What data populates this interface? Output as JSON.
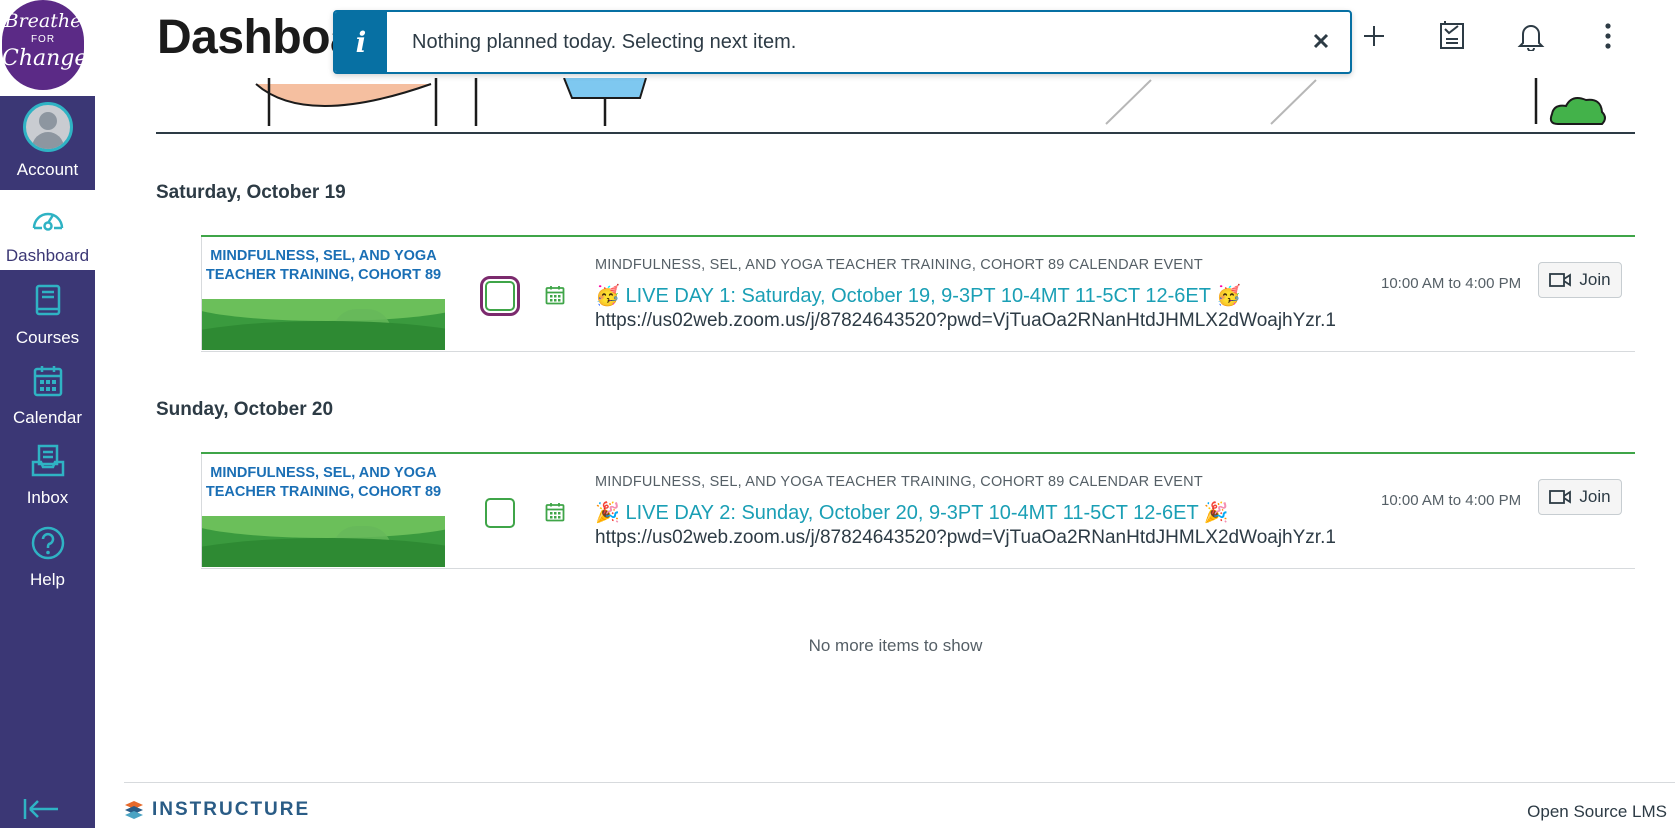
{
  "brand": {
    "line1": "Breathe",
    "line2": "FOR",
    "line3": "Change"
  },
  "nav": {
    "account": "Account",
    "dashboard": "Dashboard",
    "courses": "Courses",
    "calendar": "Calendar",
    "inbox": "Inbox",
    "help": "Help"
  },
  "header": {
    "title": "Dashboard"
  },
  "toast": {
    "message": "Nothing planned today. Selecting next item."
  },
  "colors": {
    "nav_bg": "#3b3775",
    "accent_green": "#3fa548",
    "link_teal": "#1a9fb5",
    "toast_blue": "#0770a3"
  },
  "days": [
    {
      "heading": "Saturday, October 19",
      "item": {
        "course_image_text": "MINDFULNESS, SEL, AND YOGA TEACHER TRAINING, COHORT 89",
        "type_label": "MINDFULNESS, SEL, AND YOGA TEACHER TRAINING, COHORT 89 CALENDAR EVENT",
        "title": "🥳 LIVE DAY 1: Saturday, October 19, 9-3PT 10-4MT 11-5CT 12-6ET 🥳",
        "url": "https://us02web.zoom.us/j/87824643520?pwd=VjTuaOa2RNanHtdJHMLX2dWoajhYzr.1",
        "time": "10:00 AM to 4:00 PM",
        "join": "Join"
      }
    },
    {
      "heading": "Sunday, October 20",
      "item": {
        "course_image_text": "MINDFULNESS, SEL, AND YOGA TEACHER TRAINING, COHORT 89",
        "type_label": "MINDFULNESS, SEL, AND YOGA TEACHER TRAINING, COHORT 89 CALENDAR EVENT",
        "title": "🎉 LIVE DAY 2: Sunday, October 20, 9-3PT 10-4MT 11-5CT 12-6ET 🎉",
        "url": "https://us02web.zoom.us/j/87824643520?pwd=VjTuaOa2RNanHtdJHMLX2dWoajhYzr.1",
        "time": "10:00 AM to 4:00 PM",
        "join": "Join"
      }
    }
  ],
  "empty_message": "No more items to show",
  "footer": {
    "logo_text": "INSTRUCTURE",
    "right_link": "Open Source LMS"
  }
}
